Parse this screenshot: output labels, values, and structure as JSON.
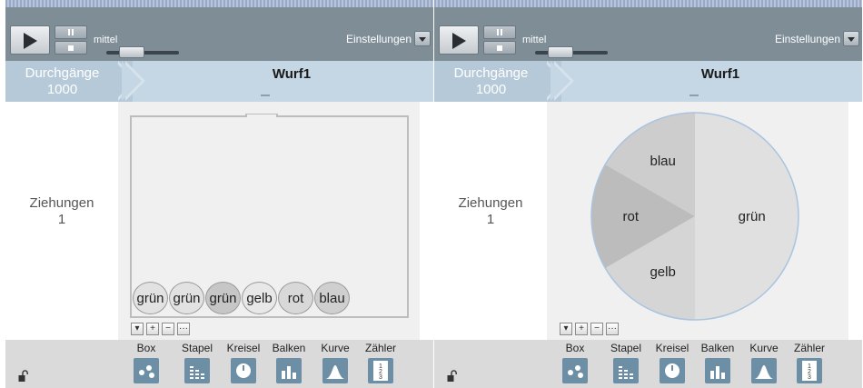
{
  "colors": {
    "toolbar": "#7f8d97",
    "header": "#c5d7e4",
    "stage": "#f0f0f0",
    "footer": "#dadada",
    "icon": "#6d8fa6"
  },
  "panels": [
    {
      "mode": "box",
      "toolbar": {
        "speed_label": "mittel",
        "settings_label": "Einstellungen"
      },
      "header": {
        "runs_label": "Durchgänge",
        "runs_value": "1000",
        "stage_title": "Wurf1"
      },
      "draws": {
        "label": "Ziehungen",
        "value": "1"
      },
      "balls": [
        {
          "label": "grün",
          "color": "#e2e2e2"
        },
        {
          "label": "grün",
          "color": "#e2e2e2"
        },
        {
          "label": "grün",
          "color": "#c6c6c6"
        },
        {
          "label": "gelb",
          "color": "#e8e8e8"
        },
        {
          "label": "rot",
          "color": "#d8d8d8"
        },
        {
          "label": "blau",
          "color": "#cfcfcf"
        }
      ],
      "zoom_buttons": [
        "▾",
        "+",
        "−",
        "···"
      ],
      "tools": [
        "Box",
        "Stapel",
        "Kreisel",
        "Balken",
        "Kurve",
        "Zähler"
      ]
    },
    {
      "mode": "spinner",
      "toolbar": {
        "speed_label": "mittel",
        "settings_label": "Einstellungen"
      },
      "header": {
        "runs_label": "Durchgänge",
        "runs_value": "1000",
        "stage_title": "Wurf1"
      },
      "draws": {
        "label": "Ziehungen",
        "value": "1"
      },
      "spinner": {
        "slices": [
          {
            "label": "grün",
            "share": 0.5,
            "color": "#e0e0e0"
          },
          {
            "label": "gelb",
            "share": 0.1667,
            "color": "#d5d5d5"
          },
          {
            "label": "rot",
            "share": 0.1667,
            "color": "#bcbcbc"
          },
          {
            "label": "blau",
            "share": 0.1667,
            "color": "#cdcdcd"
          }
        ]
      },
      "zoom_buttons": [
        "▾",
        "+",
        "−",
        "···"
      ],
      "tools": [
        "Box",
        "Stapel",
        "Kreisel",
        "Balken",
        "Kurve",
        "Zähler"
      ]
    }
  ]
}
